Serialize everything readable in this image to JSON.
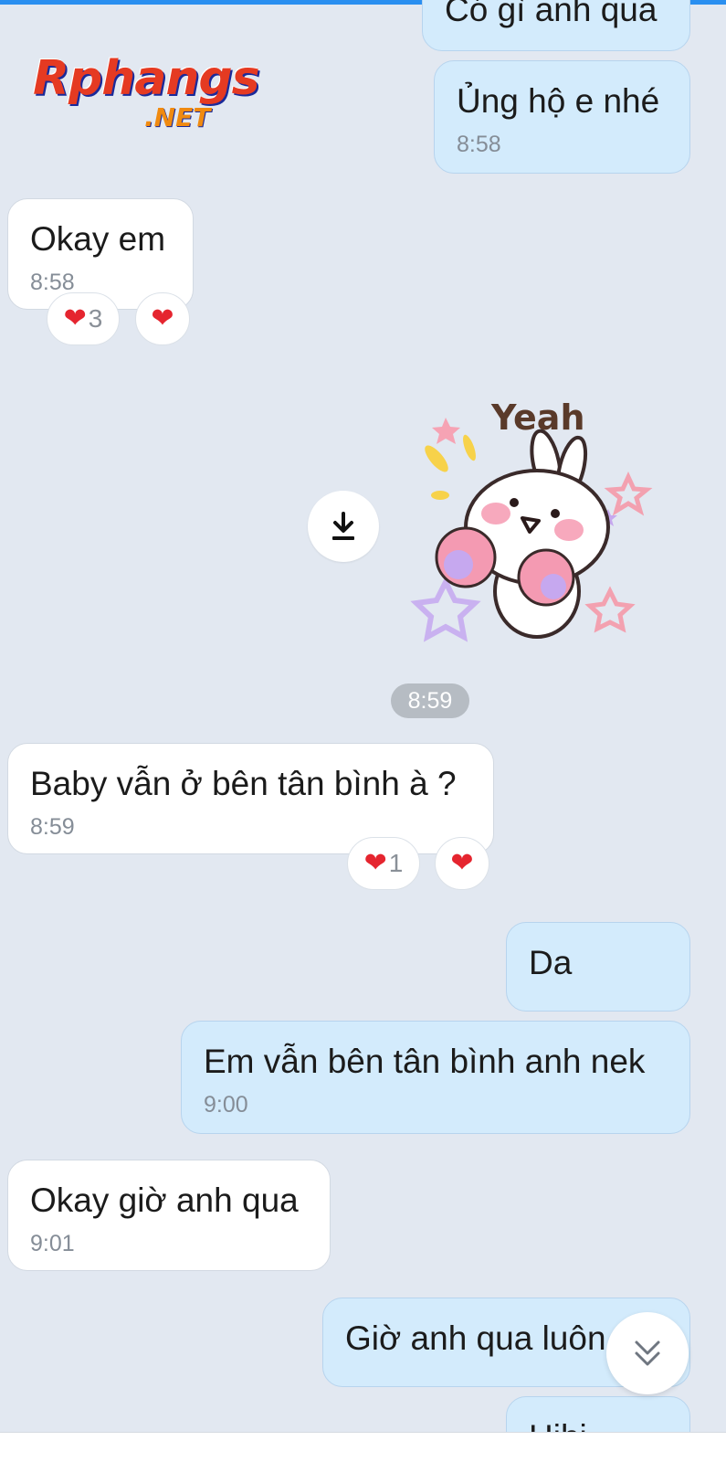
{
  "logo": {
    "line1": "Rphangs",
    "line2": ".NET"
  },
  "messages": [
    {
      "text": "Có gì anh qua",
      "time": ""
    },
    {
      "text": "Ủng hộ e nhé",
      "time": "8:58"
    },
    {
      "text": "Okay em",
      "time": "8:58"
    },
    {
      "text": "Baby vẫn ở bên tân bình à ?",
      "time": "8:59"
    },
    {
      "text": "Da",
      "time": ""
    },
    {
      "text": "Em vẫn bên tân bình anh nek",
      "time": "9:00"
    },
    {
      "text": "Okay giờ anh qua",
      "time": "9:01"
    },
    {
      "text": "Giờ anh qua luôn",
      "time": ""
    },
    {
      "text": "Hihi",
      "time": ""
    }
  ],
  "reactions": {
    "okay_em_count": "3",
    "baby_count": "1"
  },
  "sticker": {
    "caption": "Yeah"
  },
  "time_divider": "8:59",
  "colors": {
    "background": "#e2e8f1",
    "outgoing_bubble": "#d3ebfc",
    "incoming_bubble": "#ffffff",
    "heart": "#e5252f",
    "accent": "#2a8ff0"
  },
  "icons": {
    "download": "download-icon",
    "scroll_down": "double-chevron-down-icon",
    "reaction": "heart-icon"
  }
}
